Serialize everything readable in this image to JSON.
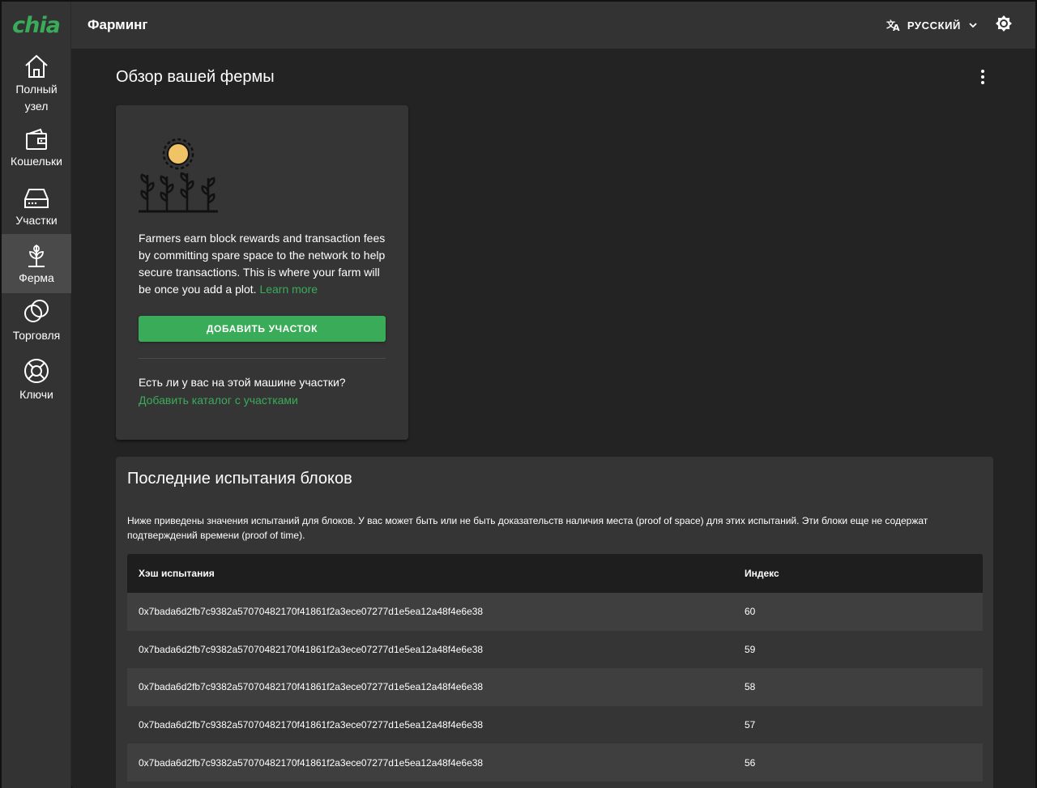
{
  "app": {
    "logo": "chia",
    "page_title": "Фарминг"
  },
  "header": {
    "language": "РУССКИЙ"
  },
  "sidebar": {
    "items": [
      {
        "label": "Полный узел",
        "icon": "home-icon"
      },
      {
        "label": "Кошельки",
        "icon": "wallet-icon"
      },
      {
        "label": "Участки",
        "icon": "hard-drive-icon"
      },
      {
        "label": "Ферма",
        "icon": "sprout-icon",
        "active": true
      },
      {
        "label": "Торговля",
        "icon": "trade-circles-icon"
      },
      {
        "label": "Ключи",
        "icon": "lifebuoy-icon"
      }
    ]
  },
  "overview": {
    "title": "Обзор вашей фермы",
    "card": {
      "text": "Farmers earn block rewards and transaction fees by committing spare space to the network to help secure transactions. This is where your farm will be once you add a plot.",
      "learn_more": "Learn more",
      "add_plot_button": "ДОБАВИТЬ УЧАСТОК",
      "question": "Есть ли у вас на этой машине участки?",
      "add_dir_link": "Добавить каталог с участками"
    }
  },
  "challenges": {
    "title": "Последние испытания блоков",
    "description": "Ниже приведены значения испытаний для блоков. У вас может быть или не быть доказательств наличия места (proof of space) для этих испытаний. Эти блоки еще не содержат подтверждений времени (proof of time).",
    "columns": [
      "Хэш испытания",
      "Индекс"
    ],
    "rows": [
      [
        "0x7bada6d2fb7c9382a57070482170f41861f2a3ece07277d1e5ea12a48f4e6e38",
        "60"
      ],
      [
        "0x7bada6d2fb7c9382a57070482170f41861f2a3ece07277d1e5ea12a48f4e6e38",
        "59"
      ],
      [
        "0x7bada6d2fb7c9382a57070482170f41861f2a3ece07277d1e5ea12a48f4e6e38",
        "58"
      ],
      [
        "0x7bada6d2fb7c9382a57070482170f41861f2a3ece07277d1e5ea12a48f4e6e38",
        "57"
      ],
      [
        "0x7bada6d2fb7c9382a57070482170f41861f2a3ece07277d1e5ea12a48f4e6e38",
        "56"
      ]
    ]
  },
  "colors": {
    "accent": "#3aac59",
    "sidebar_bg": "#333333",
    "active_bg": "#4a4a4a",
    "main_bg": "#232323",
    "card_bg": "#353535"
  }
}
